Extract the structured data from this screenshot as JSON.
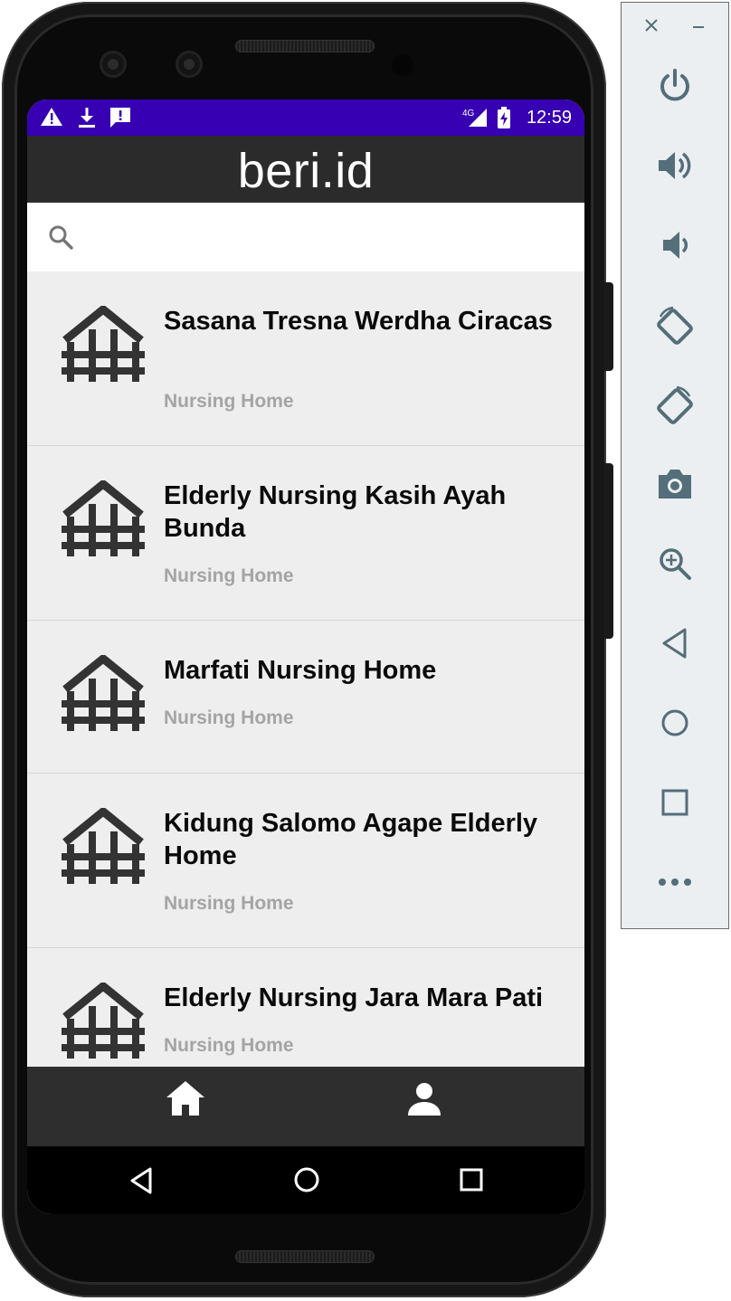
{
  "status_bar": {
    "time": "12:59",
    "network": "4G"
  },
  "app": {
    "title": "beri.id"
  },
  "search": {
    "placeholder": ""
  },
  "list": {
    "items": [
      {
        "title": "Sasana Tresna Werdha Ciracas",
        "subtitle": "Nursing Home"
      },
      {
        "title": "Elderly Nursing Kasih Ayah Bunda",
        "subtitle": "Nursing Home"
      },
      {
        "title": "Marfati Nursing Home",
        "subtitle": "Nursing Home"
      },
      {
        "title": "Kidung Salomo Agape Elderly Home",
        "subtitle": "Nursing Home"
      },
      {
        "title": "Elderly Nursing Jara Mara Pati",
        "subtitle": "Nursing Home"
      }
    ]
  },
  "bottom_nav": {
    "items": [
      {
        "icon": "home-icon"
      },
      {
        "icon": "person-icon"
      }
    ]
  },
  "emulator_toolbar": {
    "buttons": [
      {
        "icon": "power-icon"
      },
      {
        "icon": "volume-up-icon"
      },
      {
        "icon": "volume-down-icon"
      },
      {
        "icon": "rotate-left-icon"
      },
      {
        "icon": "rotate-right-icon"
      },
      {
        "icon": "camera-icon"
      },
      {
        "icon": "zoom-icon"
      },
      {
        "icon": "back-icon"
      },
      {
        "icon": "home-circle-icon"
      },
      {
        "icon": "overview-icon"
      },
      {
        "icon": "more-icon"
      }
    ]
  },
  "colors": {
    "status_bar": "#3700b3",
    "app_bar": "#2b2b2b",
    "list_background": "#eeeeee",
    "subtitle_text": "#a4a4a4",
    "bottom_nav": "#2e2e2e",
    "toolbar_icon": "#546e7a"
  }
}
